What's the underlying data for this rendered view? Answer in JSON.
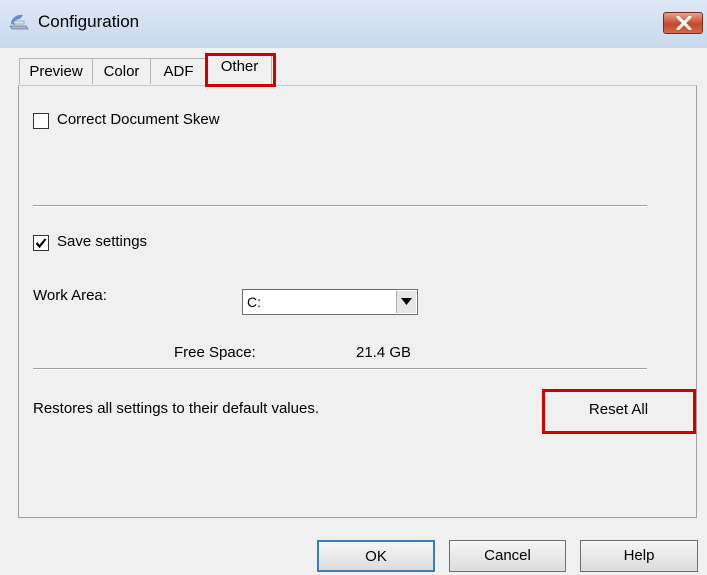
{
  "window": {
    "title": "Configuration",
    "icon": "scanner-icon",
    "close_icon": "close-icon"
  },
  "tabs": [
    {
      "label": "Preview",
      "active": false
    },
    {
      "label": "Color",
      "active": false
    },
    {
      "label": "ADF",
      "active": false
    },
    {
      "label": "Other",
      "active": true
    }
  ],
  "other": {
    "correct_skew": {
      "label": "Correct Document Skew",
      "checked": false
    },
    "save_settings": {
      "label": "Save settings",
      "checked": true
    },
    "work_area": {
      "label": "Work Area:",
      "value": "C:"
    },
    "free_space": {
      "label": "Free Space:",
      "value": "21.4 GB"
    },
    "restore_text": "Restores all settings to their default values.",
    "reset_button": "Reset All"
  },
  "buttons": {
    "ok": "OK",
    "cancel": "Cancel",
    "help": "Help"
  },
  "colors": {
    "highlight": "#d40000",
    "titlebar": "#c9d9ee",
    "close_button": "#c4482c"
  }
}
